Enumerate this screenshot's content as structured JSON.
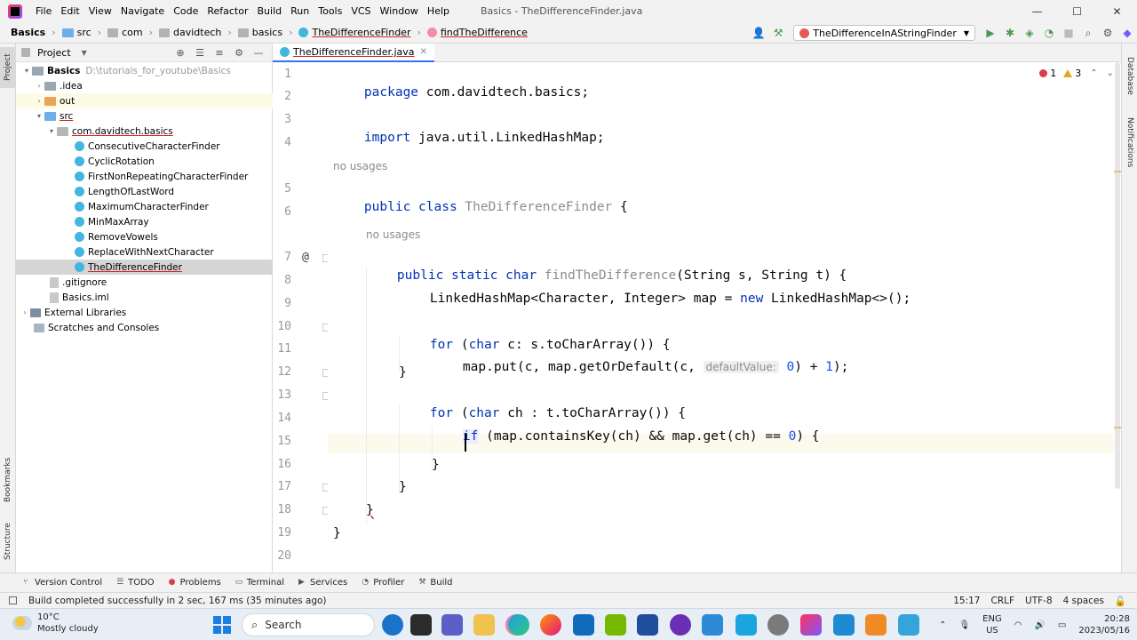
{
  "menubar": {
    "items": [
      "File",
      "Edit",
      "View",
      "Navigate",
      "Code",
      "Refactor",
      "Build",
      "Run",
      "Tools",
      "VCS",
      "Window",
      "Help"
    ],
    "window_title": "Basics - TheDifferenceFinder.java",
    "minimize": "—",
    "maximize": "☐",
    "close": "✕"
  },
  "navbar": {
    "crumbs": [
      "Basics",
      "src",
      "com",
      "davidtech",
      "basics",
      "TheDifferenceFinder",
      "findTheDifference"
    ],
    "run_config": "TheDifferenceInAStringFinder"
  },
  "left_strip": {
    "project": "Project",
    "bookmarks": "Bookmarks",
    "structure": "Structure"
  },
  "right_strip": {
    "database": "Database",
    "notifications": "Notifications"
  },
  "project_panel": {
    "title": "Project",
    "tree": [
      {
        "label": "Basics",
        "hint": "D:\\tutorials_for_youtube\\Basics",
        "arrow": "▾"
      },
      {
        "label": ".idea",
        "arrow": "›"
      },
      {
        "label": "out",
        "arrow": "›"
      },
      {
        "label": "src",
        "arrow": "▾"
      },
      {
        "label": "com.davidtech.basics",
        "arrow": "▾"
      },
      {
        "label": "ConsecutiveCharacterFinder"
      },
      {
        "label": "CyclicRotation"
      },
      {
        "label": "FirstNonRepeatingCharacterFinder"
      },
      {
        "label": "LengthOfLastWord"
      },
      {
        "label": "MaximumCharacterFinder"
      },
      {
        "label": "MinMaxArray"
      },
      {
        "label": "RemoveVowels"
      },
      {
        "label": "ReplaceWithNextCharacter"
      },
      {
        "label": "TheDifferenceFinder"
      },
      {
        "label": ".gitignore"
      },
      {
        "label": "Basics.iml"
      },
      {
        "label": "External Libraries",
        "arrow": "›"
      },
      {
        "label": "Scratches and Consoles"
      }
    ]
  },
  "editor": {
    "tab": "TheDifferenceFinder.java",
    "inspections": {
      "errors": "1",
      "warnings": "3"
    },
    "usages_label": "no usages",
    "line_numbers": [
      "1",
      "2",
      "3",
      "4",
      "5",
      "6",
      "7",
      "8",
      "9",
      "10",
      "11",
      "12",
      "13",
      "14",
      "15",
      "16",
      "17",
      "18",
      "19",
      "20"
    ],
    "lines": {
      "l1": [
        "package ",
        "com.davidtech.basics;"
      ],
      "l3": [
        "import ",
        "java.util.LinkedHashMap;"
      ],
      "l5": [
        "public class ",
        "TheDifferenceFinder",
        " {"
      ],
      "l7": [
        "public static char ",
        "findTheDifference",
        "(String s, String t) {"
      ],
      "l8": [
        "LinkedHashMap<Character, Integer> map = ",
        "new ",
        "LinkedHashMap<>();"
      ],
      "l10": [
        "for ",
        "(",
        "char ",
        "c: s.toCharArray()) {"
      ],
      "l11": [
        "map.put(c, map.getOrDefault(c, ",
        "defaultValue:",
        "0",
        ") + ",
        "1",
        ");"
      ],
      "l12": "}",
      "l13": [
        "for ",
        "(",
        "char ",
        "ch : t.toCharArray()) {"
      ],
      "l14": [
        "if",
        " (map.containsKey(ch) && map.get(ch) == ",
        "0",
        ") {"
      ],
      "l16": "}",
      "l17": "}",
      "l18": "}",
      "l19": "}"
    }
  },
  "tool_tabs": [
    "Version Control",
    "TODO",
    "Problems",
    "Terminal",
    "Services",
    "Profiler",
    "Build"
  ],
  "status": {
    "message": "Build completed successfully in 2 sec, 167 ms (35 minutes ago)",
    "position": "15:17",
    "line_sep": "CRLF",
    "encoding": "UTF-8",
    "indent": "4 spaces"
  },
  "taskbar": {
    "temp": "10°C",
    "weather": "Mostly cloudy",
    "search": "Search",
    "lang1": "ENG",
    "lang2": "US",
    "time": "20:28",
    "date": "2023/05/16"
  }
}
